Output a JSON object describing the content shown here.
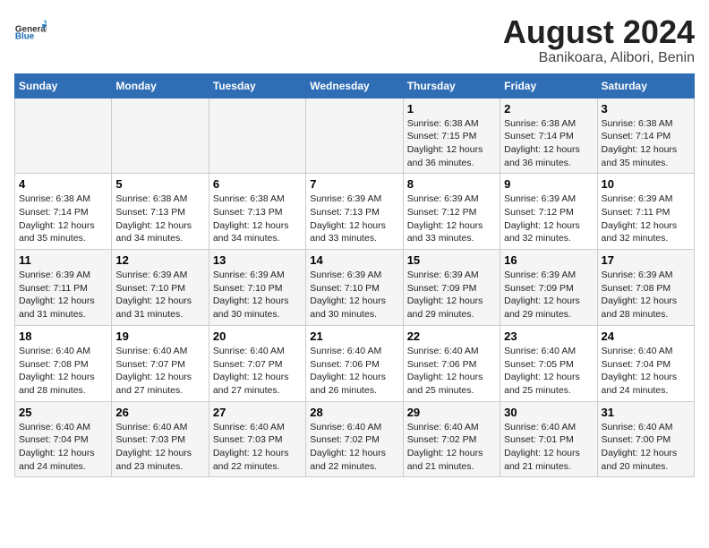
{
  "header": {
    "logo_line1": "General",
    "logo_line2": "Blue",
    "main_title": "August 2024",
    "subtitle": "Banikoara, Alibori, Benin"
  },
  "days_of_week": [
    "Sunday",
    "Monday",
    "Tuesday",
    "Wednesday",
    "Thursday",
    "Friday",
    "Saturday"
  ],
  "weeks": [
    [
      {
        "day": "",
        "info": ""
      },
      {
        "day": "",
        "info": ""
      },
      {
        "day": "",
        "info": ""
      },
      {
        "day": "",
        "info": ""
      },
      {
        "day": "1",
        "info": "Sunrise: 6:38 AM\nSunset: 7:15 PM\nDaylight: 12 hours\nand 36 minutes."
      },
      {
        "day": "2",
        "info": "Sunrise: 6:38 AM\nSunset: 7:14 PM\nDaylight: 12 hours\nand 36 minutes."
      },
      {
        "day": "3",
        "info": "Sunrise: 6:38 AM\nSunset: 7:14 PM\nDaylight: 12 hours\nand 35 minutes."
      }
    ],
    [
      {
        "day": "4",
        "info": "Sunrise: 6:38 AM\nSunset: 7:14 PM\nDaylight: 12 hours\nand 35 minutes."
      },
      {
        "day": "5",
        "info": "Sunrise: 6:38 AM\nSunset: 7:13 PM\nDaylight: 12 hours\nand 34 minutes."
      },
      {
        "day": "6",
        "info": "Sunrise: 6:38 AM\nSunset: 7:13 PM\nDaylight: 12 hours\nand 34 minutes."
      },
      {
        "day": "7",
        "info": "Sunrise: 6:39 AM\nSunset: 7:13 PM\nDaylight: 12 hours\nand 33 minutes."
      },
      {
        "day": "8",
        "info": "Sunrise: 6:39 AM\nSunset: 7:12 PM\nDaylight: 12 hours\nand 33 minutes."
      },
      {
        "day": "9",
        "info": "Sunrise: 6:39 AM\nSunset: 7:12 PM\nDaylight: 12 hours\nand 32 minutes."
      },
      {
        "day": "10",
        "info": "Sunrise: 6:39 AM\nSunset: 7:11 PM\nDaylight: 12 hours\nand 32 minutes."
      }
    ],
    [
      {
        "day": "11",
        "info": "Sunrise: 6:39 AM\nSunset: 7:11 PM\nDaylight: 12 hours\nand 31 minutes."
      },
      {
        "day": "12",
        "info": "Sunrise: 6:39 AM\nSunset: 7:10 PM\nDaylight: 12 hours\nand 31 minutes."
      },
      {
        "day": "13",
        "info": "Sunrise: 6:39 AM\nSunset: 7:10 PM\nDaylight: 12 hours\nand 30 minutes."
      },
      {
        "day": "14",
        "info": "Sunrise: 6:39 AM\nSunset: 7:10 PM\nDaylight: 12 hours\nand 30 minutes."
      },
      {
        "day": "15",
        "info": "Sunrise: 6:39 AM\nSunset: 7:09 PM\nDaylight: 12 hours\nand 29 minutes."
      },
      {
        "day": "16",
        "info": "Sunrise: 6:39 AM\nSunset: 7:09 PM\nDaylight: 12 hours\nand 29 minutes."
      },
      {
        "day": "17",
        "info": "Sunrise: 6:39 AM\nSunset: 7:08 PM\nDaylight: 12 hours\nand 28 minutes."
      }
    ],
    [
      {
        "day": "18",
        "info": "Sunrise: 6:40 AM\nSunset: 7:08 PM\nDaylight: 12 hours\nand 28 minutes."
      },
      {
        "day": "19",
        "info": "Sunrise: 6:40 AM\nSunset: 7:07 PM\nDaylight: 12 hours\nand 27 minutes."
      },
      {
        "day": "20",
        "info": "Sunrise: 6:40 AM\nSunset: 7:07 PM\nDaylight: 12 hours\nand 27 minutes."
      },
      {
        "day": "21",
        "info": "Sunrise: 6:40 AM\nSunset: 7:06 PM\nDaylight: 12 hours\nand 26 minutes."
      },
      {
        "day": "22",
        "info": "Sunrise: 6:40 AM\nSunset: 7:06 PM\nDaylight: 12 hours\nand 25 minutes."
      },
      {
        "day": "23",
        "info": "Sunrise: 6:40 AM\nSunset: 7:05 PM\nDaylight: 12 hours\nand 25 minutes."
      },
      {
        "day": "24",
        "info": "Sunrise: 6:40 AM\nSunset: 7:04 PM\nDaylight: 12 hours\nand 24 minutes."
      }
    ],
    [
      {
        "day": "25",
        "info": "Sunrise: 6:40 AM\nSunset: 7:04 PM\nDaylight: 12 hours\nand 24 minutes."
      },
      {
        "day": "26",
        "info": "Sunrise: 6:40 AM\nSunset: 7:03 PM\nDaylight: 12 hours\nand 23 minutes."
      },
      {
        "day": "27",
        "info": "Sunrise: 6:40 AM\nSunset: 7:03 PM\nDaylight: 12 hours\nand 22 minutes."
      },
      {
        "day": "28",
        "info": "Sunrise: 6:40 AM\nSunset: 7:02 PM\nDaylight: 12 hours\nand 22 minutes."
      },
      {
        "day": "29",
        "info": "Sunrise: 6:40 AM\nSunset: 7:02 PM\nDaylight: 12 hours\nand 21 minutes."
      },
      {
        "day": "30",
        "info": "Sunrise: 6:40 AM\nSunset: 7:01 PM\nDaylight: 12 hours\nand 21 minutes."
      },
      {
        "day": "31",
        "info": "Sunrise: 6:40 AM\nSunset: 7:00 PM\nDaylight: 12 hours\nand 20 minutes."
      }
    ]
  ]
}
